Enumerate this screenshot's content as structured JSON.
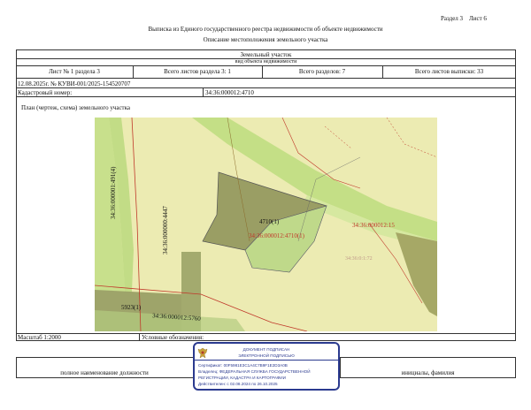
{
  "header": {
    "section": "Раздел 3",
    "sheet": "Лист 6",
    "title": "Выписка из Единого государственного реестра недвижимости об объекте недвижимости",
    "subtitle": "Описание местоположения земельного участка"
  },
  "object": {
    "name": "Земельный участок",
    "kind": "вид объекта недвижимости"
  },
  "sheet_row": {
    "sheet_of_section": "Лист № 1 раздела 3",
    "total_section_sheets": "Всего листов раздела 3: 1",
    "total_sections": "Всего разделов: 7",
    "total_sheets": "Всего листов выписки: 33"
  },
  "ref": {
    "doc_number": "12.08.2025г. № КУВИ-001/2025-154520707",
    "cadastral_label": "Кадастровый номер:",
    "cadastral_value": "34:36:000012:4710"
  },
  "plan": {
    "label": "План (чертеж, схема) земельного участка",
    "map_labels": {
      "parcel_main": "4710(1)",
      "parcel_main_full": "34:36:000012:4710(1)",
      "parcel_right": "34:36:000012:15",
      "parcel_east": "34:36:0:1:72",
      "vertical_1": "34:36:000001:491(4)",
      "vertical_2": "34:36:000000:4447",
      "bottom_block": "5923(1)",
      "bottom_road": "34:36:000012:5760"
    }
  },
  "footer": {
    "scale": "Масштаб 1:2000",
    "legend_label": "Условные обозначения:",
    "position_label": "полное наименование должности",
    "initials_label": "инициалы, фамилия"
  },
  "stamp": {
    "line1": "ДОКУМЕНТ ПОДПИСАН",
    "line2": "ЭЛЕКТРОННОЙ ПОДПИСЬЮ",
    "cert": "Сертификат: 00F5981E3C1A4C7B9F1E2D3A0B",
    "owner": "Владелец: ФЕДЕРАЛЬНАЯ СЛУЖБА ГОСУДАРСТВЕННОЙ",
    "owner2": "РЕГИСТРАЦИИ, КАДАСТРА И КАРТОГРАФИИ",
    "valid": "Действителен: с 02.08.2024 по 26.10.2025"
  }
}
